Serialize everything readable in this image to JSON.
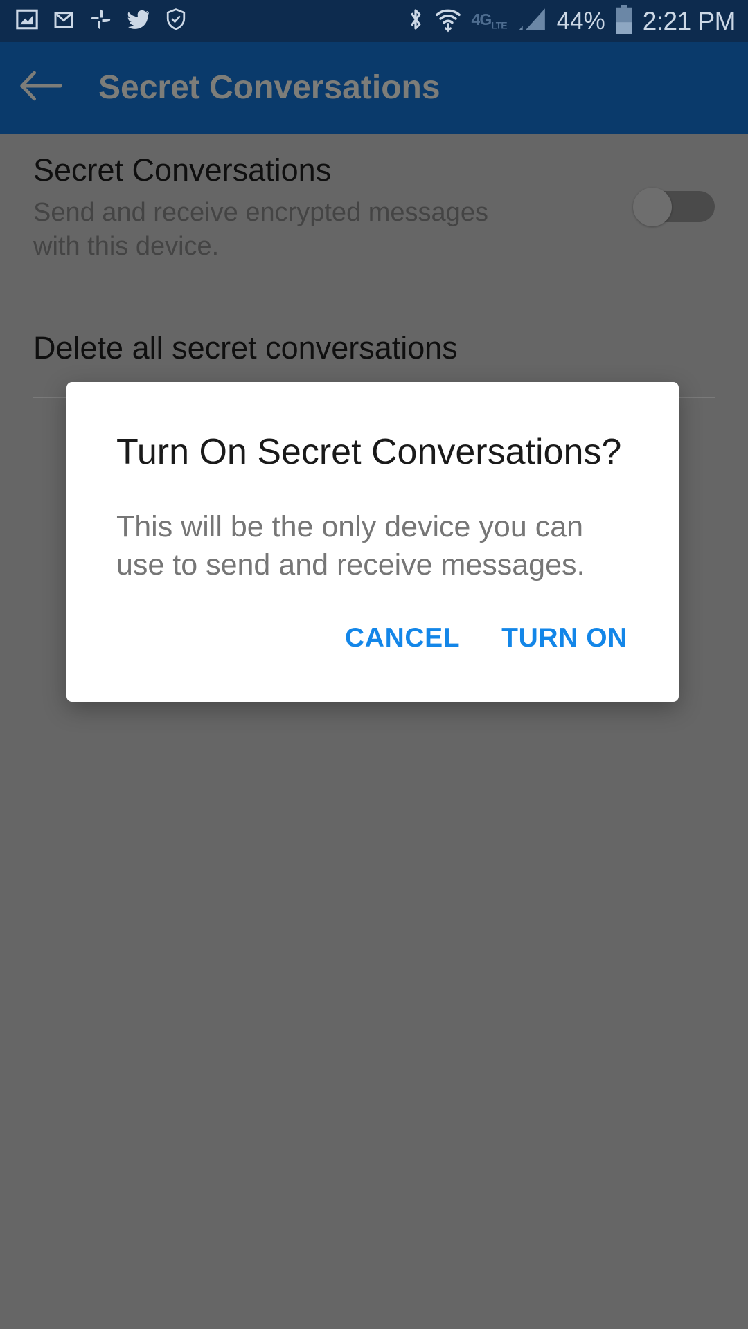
{
  "status_bar": {
    "background_color": "#0d2b4e",
    "icon_color": "#ccd8e6",
    "left_icons": [
      {
        "name": "screenshot-icon",
        "label": "Screenshot"
      },
      {
        "name": "gmail-icon",
        "label": "Gmail"
      },
      {
        "name": "google-photos-icon",
        "label": "Photos"
      },
      {
        "name": "twitter-icon",
        "label": "Twitter"
      },
      {
        "name": "shield-check-icon",
        "label": "Security"
      }
    ],
    "right_icons": [
      {
        "name": "bluetooth-icon",
        "label": "Bluetooth"
      },
      {
        "name": "wifi-icon",
        "label": "Wi-Fi"
      },
      {
        "name": "cellular-signal-icon",
        "label": "Signal"
      },
      {
        "name": "battery-icon",
        "label": "Battery"
      }
    ],
    "network_type": "4G",
    "network_type_sub": "LTE",
    "battery_percent": "44%",
    "battery_level": 44,
    "clock": "2:21 PM"
  },
  "app_bar": {
    "background_color": "#0a3a6b",
    "back_icon": "arrow-left-icon",
    "title": "Secret Conversations"
  },
  "settings": {
    "background_color": "#666666",
    "rows": [
      {
        "title": "Secret Conversations",
        "subtitle": "Send and receive encrypted messages with this device.",
        "has_toggle": true,
        "toggle_on": false
      },
      {
        "title": "Delete all secret conversations",
        "subtitle": "",
        "has_toggle": false
      }
    ]
  },
  "dialog": {
    "title": "Turn On Secret Conversations?",
    "body": "This will be the only device you can use to send and receive messages.",
    "accent_color": "#1386e8",
    "cancel_label": "CANCEL",
    "confirm_label": "TURN ON"
  }
}
